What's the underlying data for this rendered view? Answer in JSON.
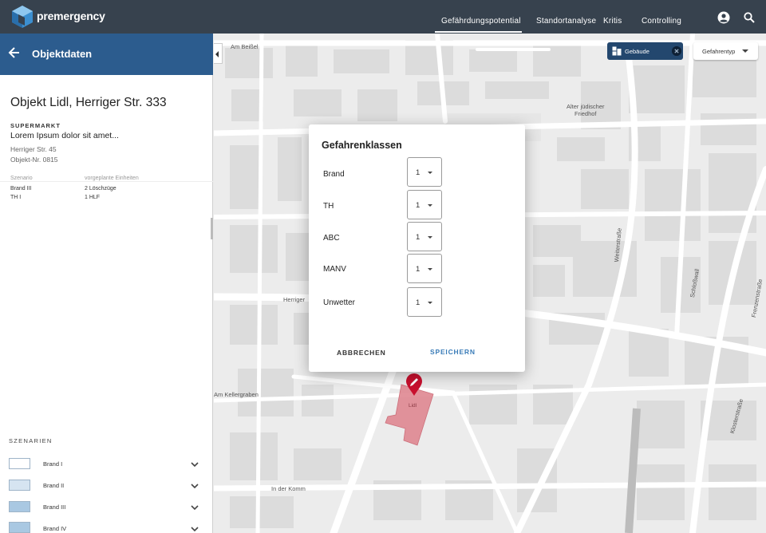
{
  "app": {
    "brand": "premergency",
    "nav": [
      {
        "label": "Gefährdungspotential",
        "active": true
      },
      {
        "label": "Standortanalyse",
        "active": false
      },
      {
        "label": "Kritis",
        "active": false
      },
      {
        "label": "Controlling",
        "active": false
      }
    ],
    "icons": {
      "account": "account-circle-icon",
      "search": "search-icon"
    }
  },
  "panel": {
    "header_title": "Objektdaten",
    "object_title": "Objekt Lidl, Herriger Str. 333",
    "category": "SUPERMARKT",
    "description": "Lorem Ipsum dolor sit amet...",
    "address": "Herriger Str. 45",
    "object_number": "Objekt-Nr. 0815",
    "table": {
      "headers": [
        "Szenario",
        "vorgeplante Einheiten"
      ],
      "rows": [
        [
          "Brand III",
          "2 Löschzüge"
        ],
        [
          "TH I",
          "1 HLF"
        ]
      ]
    },
    "scenarios_heading": "SZENARIEN",
    "scenarios": [
      {
        "label": "Brand I",
        "color": "#ffffff"
      },
      {
        "label": "Brand II",
        "color": "#d6e4f1"
      },
      {
        "label": "Brand III",
        "color": "#a9c8e2"
      },
      {
        "label": "Brand IV",
        "color": "#a9c8e2"
      }
    ]
  },
  "map": {
    "filter_chip": "Gebäude",
    "type_dropdown": "Gefahrentyp",
    "streets": [
      {
        "name": "Am Beißel"
      },
      {
        "name": "Alter jüdischer"
      },
      {
        "name": "Friedhof"
      },
      {
        "name": "Herriger"
      },
      {
        "name": "Am Kellergraben"
      },
      {
        "name": "In der Komm"
      },
      {
        "name": "Lidl"
      },
      {
        "name": "Weiterstraße"
      },
      {
        "name": "Schloßwall"
      },
      {
        "name": "Frenzenstraße"
      },
      {
        "name": "Klosterstraße"
      }
    ],
    "highlight_color": "#e08a94",
    "marker_color": "#c8102e"
  },
  "dialog": {
    "title": "Gefahrenklassen",
    "rows": [
      {
        "label": "Brand",
        "value": "1"
      },
      {
        "label": "TH",
        "value": "1"
      },
      {
        "label": "ABC",
        "value": "1"
      },
      {
        "label": "MANV",
        "value": "1"
      },
      {
        "label": "Unwetter",
        "value": "1"
      }
    ],
    "cancel": "ABBRECHEN",
    "save": "SPEICHERN",
    "save_color": "#3a7cb8"
  }
}
